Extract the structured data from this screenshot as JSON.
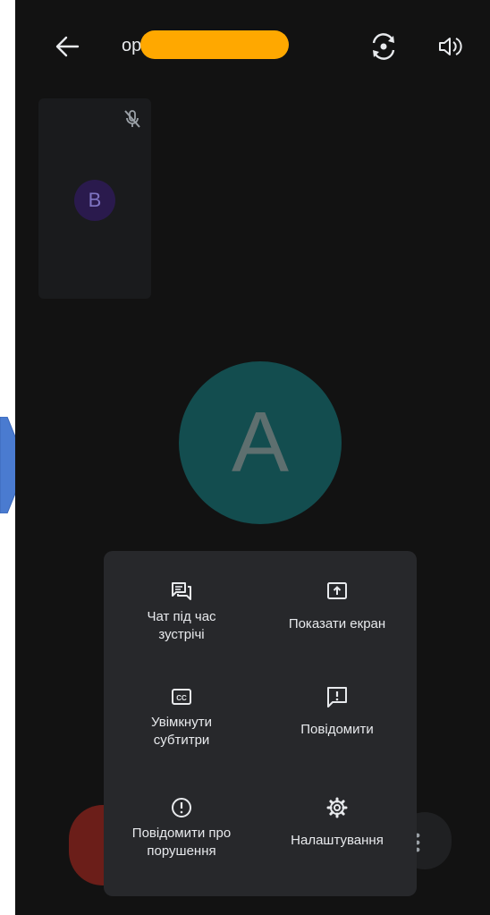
{
  "header": {
    "title_visible": "op",
    "back_icon": "arrow-back-icon",
    "switch_camera_icon": "switch-camera-icon",
    "speaker_icon": "volume-icon"
  },
  "participants": {
    "tile_initial": "B",
    "main_initial": "A"
  },
  "menu": {
    "items": [
      {
        "label": "Чат під час\nзустрічі",
        "icon": "chat-icon"
      },
      {
        "label": "Показати екран",
        "icon": "present-screen-icon"
      },
      {
        "label": "Увімкнути\nсубтитри",
        "icon": "captions-icon"
      },
      {
        "label": "Повідомити",
        "icon": "feedback-icon"
      },
      {
        "label": "Повідомити про\nпорушення",
        "icon": "report-abuse-icon"
      },
      {
        "label": "Налаштування",
        "icon": "settings-icon"
      }
    ]
  },
  "colors": {
    "background": "#121212",
    "menu_bg": "#27282b",
    "avatar_a": "#134d4f",
    "avatar_b": "#2a1a4d",
    "end_call": "#6b1e19",
    "redaction": "#ffa800",
    "arrow_tab": "#4a7bd0"
  }
}
